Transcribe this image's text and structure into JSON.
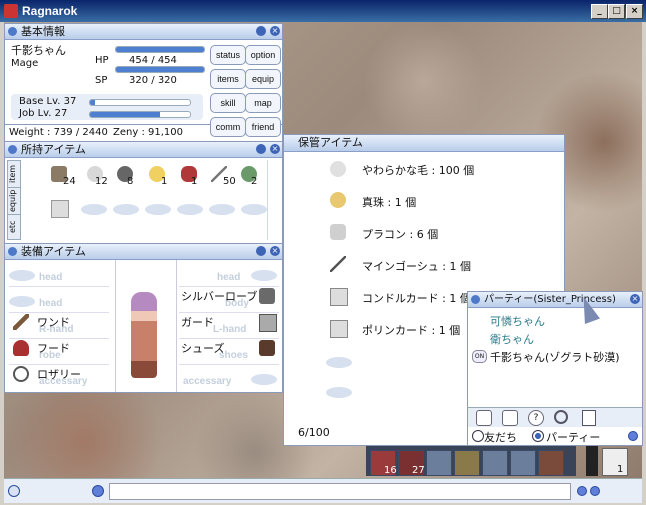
{
  "window": {
    "title": "Ragnarok",
    "min": "_",
    "max": "□",
    "close": "×"
  },
  "basic_info": {
    "title": "基本情報",
    "name": "千影ちゃん",
    "job": "Mage",
    "hp_label": "HP",
    "hp_value": "454  /  454",
    "hp_fraction": 1.0,
    "sp_label": "SP",
    "sp_value": "320  /  320",
    "sp_fraction": 1.0,
    "base_lv": "Base Lv. 37",
    "base_fraction": 0.05,
    "job_lv": "Job Lv. 27",
    "job_fraction": 0.7,
    "weight": "Weight : 739 / 2440",
    "zeny": "Zeny : 91,100",
    "buttons": [
      "status",
      "option",
      "items",
      "equip",
      "skill",
      "map",
      "comm",
      "friend"
    ]
  },
  "inventory": {
    "title": "所持アイテム",
    "tabs": [
      "item",
      "equip",
      "etc"
    ],
    "quantities": [
      "24",
      "12",
      "8",
      "1",
      "1",
      "50",
      "2"
    ]
  },
  "equipment": {
    "title": "装備アイテム",
    "left_slots": [
      {
        "ghost": "head",
        "item": ""
      },
      {
        "ghost": "head",
        "item": ""
      },
      {
        "ghost": "R-hand",
        "item": "ワンド"
      },
      {
        "ghost": "robe",
        "item": "フード"
      },
      {
        "ghost": "accessary",
        "item": "ロザリー"
      }
    ],
    "right_slots": [
      {
        "ghost": "head",
        "item": ""
      },
      {
        "ghost": "body",
        "item": "シルバーローブ"
      },
      {
        "ghost": "L-hand",
        "item": "ガード"
      },
      {
        "ghost": "shoes",
        "item": "シューズ"
      },
      {
        "ghost": "accessary",
        "item": ""
      }
    ]
  },
  "storage": {
    "title": "保管アイテム",
    "items": [
      "やわらかな毛 : 100 個",
      "真珠 : 1 個",
      "プラコン : 6 個",
      "マインゴーシュ : 1 個",
      "コンドルカード : 1 個",
      "ポリンカード : 1 個"
    ],
    "count": "6/100"
  },
  "party": {
    "title": "パーティー(Sister_Princess)",
    "members": [
      "可憐ちゃん",
      "衛ちゃん",
      "千影ちゃん(ゾグラト砂漠)"
    ],
    "on_badge": "ON",
    "tab_friends": "友だち",
    "tab_party": "パーティー"
  },
  "hotbar": {
    "counts": [
      "16",
      "27",
      "1"
    ]
  },
  "colors": {
    "accent": "#4e78c8",
    "party_member": "#2a7a8a"
  }
}
